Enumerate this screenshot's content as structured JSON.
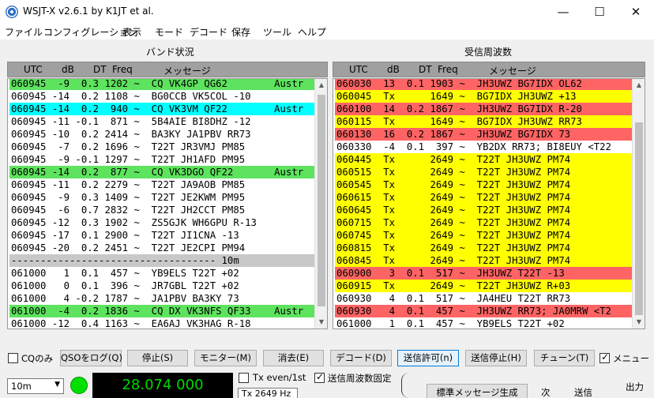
{
  "window": {
    "title": "WSJT-X   v2.6.1   by K1JT et al.",
    "minimize": "—",
    "maximize": "☐",
    "close": "✕"
  },
  "menu": [
    "ファイル",
    "コンフィグレーション",
    "表示",
    "モード",
    "デコード",
    "保存",
    "ツール",
    "ヘルプ"
  ],
  "band_activity": {
    "title": "バンド状況",
    "headers": {
      "utc": "UTC",
      "db": "dB",
      "dt": "DT",
      "freq": "Freq",
      "msg": "メッセージ"
    },
    "rows": [
      {
        "text": "060945  -9  0.3 1202 ~  CQ VK4GP QG62        Austr",
        "bg": "#5ee35e"
      },
      {
        "text": "060945 -14  0.2 1108 ~  BG0CCB VK5COL -10",
        "bg": ""
      },
      {
        "text": "060945 -14  0.2  940 ~  CQ VK3VM QF22        Austr",
        "bg": "#00ffff"
      },
      {
        "text": "060945 -11 -0.1  871 ~  5B4AIE BI8DHZ -12",
        "bg": ""
      },
      {
        "text": "060945 -10  0.2 2414 ~  BA3KY JA1PBV RR73",
        "bg": ""
      },
      {
        "text": "060945  -7  0.2 1696 ~  T22T JR3VMJ PM85",
        "bg": ""
      },
      {
        "text": "060945  -9 -0.1 1297 ~  T22T JH1AFD PM95",
        "bg": ""
      },
      {
        "text": "060945 -14  0.2  877 ~  CQ VK3DGO QF22       Austr",
        "bg": "#5ee35e"
      },
      {
        "text": "060945 -11  0.2 2279 ~  T22T JA9AOB PM85",
        "bg": ""
      },
      {
        "text": "060945  -9  0.3 1409 ~  T22T JE2KWM PM95",
        "bg": ""
      },
      {
        "text": "060945  -6  0.7 2832 ~  T22T JH2CCT PM85",
        "bg": ""
      },
      {
        "text": "060945 -12  0.3 1902 ~  ZS5GJK WH6GPU R-13",
        "bg": ""
      },
      {
        "text": "060945 -17  0.1 2900 ~  T22T JI1CNA -13",
        "bg": ""
      },
      {
        "text": "060945 -20  0.2 2451 ~  T22T JE2CPI PM94",
        "bg": ""
      },
      {
        "text": "----------------------------------- 10m",
        "bg": "#c8c8c8"
      },
      {
        "text": "061000   1  0.1  457 ~  YB9ELS T22T +02",
        "bg": ""
      },
      {
        "text": "061000   0  0.1  396 ~  JR7GBL T22T +02",
        "bg": ""
      },
      {
        "text": "061000   4 -0.2 1787 ~  JA1PBV BA3KY 73",
        "bg": ""
      },
      {
        "text": "061000  -4  0.2 1836 ~  CQ DX VK3NFS QF33    Austr",
        "bg": "#5ee35e"
      },
      {
        "text": "061000 -12  0.4 1163 ~  EA6AJ VK3HAG R-18",
        "bg": ""
      }
    ]
  },
  "rx_frequency": {
    "title": "受信周波数",
    "headers": {
      "utc": "UTC",
      "db": "dB",
      "dt": "DT",
      "freq": "Freq",
      "msg": "メッセージ"
    },
    "rows": [
      {
        "text": "060030  13  0.1 1903 ~  JH3UWZ BG7IDX OL62",
        "bg": "#ff6464"
      },
      {
        "text": "060045  Tx      1649 ~  BG7IDX JH3UWZ +13",
        "bg": "#ffff00"
      },
      {
        "text": "060100  14  0.2 1867 ~  JH3UWZ BG7IDX R-20",
        "bg": "#ff6464"
      },
      {
        "text": "060115  Tx      1649 ~  BG7IDX JH3UWZ RR73",
        "bg": "#ffff00"
      },
      {
        "text": "060130  16  0.2 1867 ~  JH3UWZ BG7IDX 73",
        "bg": "#ff6464"
      },
      {
        "text": "060330  -4  0.1  397 ~  YB2DX RR73; BI8EUY <T22",
        "bg": ""
      },
      {
        "text": "060445  Tx      2649 ~  T22T JH3UWZ PM74",
        "bg": "#ffff00"
      },
      {
        "text": "060515  Tx      2649 ~  T22T JH3UWZ PM74",
        "bg": "#ffff00"
      },
      {
        "text": "060545  Tx      2649 ~  T22T JH3UWZ PM74",
        "bg": "#ffff00"
      },
      {
        "text": "060615  Tx      2649 ~  T22T JH3UWZ PM74",
        "bg": "#ffff00"
      },
      {
        "text": "060645  Tx      2649 ~  T22T JH3UWZ PM74",
        "bg": "#ffff00"
      },
      {
        "text": "060715  Tx      2649 ~  T22T JH3UWZ PM74",
        "bg": "#ffff00"
      },
      {
        "text": "060745  Tx      2649 ~  T22T JH3UWZ PM74",
        "bg": "#ffff00"
      },
      {
        "text": "060815  Tx      2649 ~  T22T JH3UWZ PM74",
        "bg": "#ffff00"
      },
      {
        "text": "060845  Tx      2649 ~  T22T JH3UWZ PM74",
        "bg": "#ffff00"
      },
      {
        "text": "060900   3  0.1  517 ~  JH3UWZ T22T -13",
        "bg": "#ff6464"
      },
      {
        "text": "060915  Tx      2649 ~  T22T JH3UWZ R+03",
        "bg": "#ffff00"
      },
      {
        "text": "060930   4  0.1  517 ~  JA4HEU T22T RR73",
        "bg": ""
      },
      {
        "text": "060930   4  0.1  457 ~  JH3UWZ RR73; JA0MRW <T2",
        "bg": "#ff6464"
      },
      {
        "text": "061000   1  0.1  457 ~  YB9ELS T22T +02",
        "bg": ""
      }
    ]
  },
  "controls": {
    "cq_only": "CQのみ",
    "log_qso": "QSOをログ(Q)",
    "stop": "停止(S)",
    "monitor": "モニター(M)",
    "erase": "消去(E)",
    "decode": "デコード(D)",
    "enable_tx": "送信許可(n)",
    "halt_tx": "送信停止(H)",
    "tune": "チューン(T)",
    "menus": "メニュー",
    "menus_checked": true,
    "cq_only_checked": false
  },
  "bottom": {
    "band": "10m",
    "frequency": "28.074 000",
    "tx_even": "Tx even/1st",
    "tx_even_checked": false,
    "hold_tx_freq": "送信周波数固定",
    "hold_tx_freq_checked": true,
    "tx_freq": "Tx  2649  Hz",
    "generate_std": "標準メッセージ生成",
    "next": "次",
    "now": "送信",
    "output": "出力"
  },
  "colors": {
    "cq": "#5ee35e",
    "my_call": "#ff6464",
    "tx": "#ffff00",
    "new_dxcc": "#00ffff",
    "separator": "#c8c8c8"
  }
}
